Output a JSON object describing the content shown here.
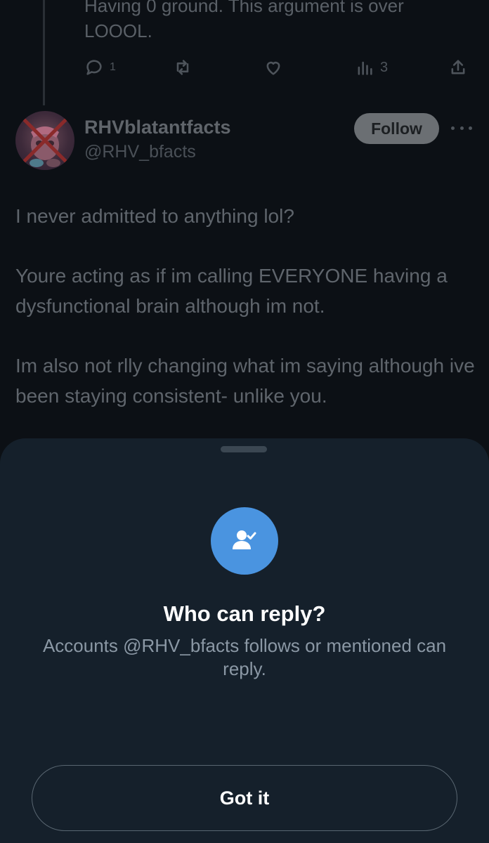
{
  "previous_tweet": {
    "text_lines": [
      "Having 0 ground. This argument is over",
      "LOOOL."
    ],
    "reply_count": "1",
    "views_count": "3"
  },
  "tweet": {
    "display_name": "RHVblatantfacts",
    "handle": "@RHV_bfacts",
    "follow_label": "Follow",
    "paragraphs": [
      "I never admitted to anything lol?",
      "Youre acting as if im calling EVERYONE having a dysfunctional brain although im not.",
      "Im also not rlly changing what im saying although ive been staying consistent- unlike you."
    ]
  },
  "sheet": {
    "icon": "person-check-icon",
    "title": "Who can reply?",
    "description": "Accounts @RHV_bfacts follows or mentioned can reply.",
    "button_label": "Got it"
  },
  "colors": {
    "sheet_background": "#15202b",
    "accent_blue": "#4a94e0",
    "page_background": "#0c1015"
  }
}
